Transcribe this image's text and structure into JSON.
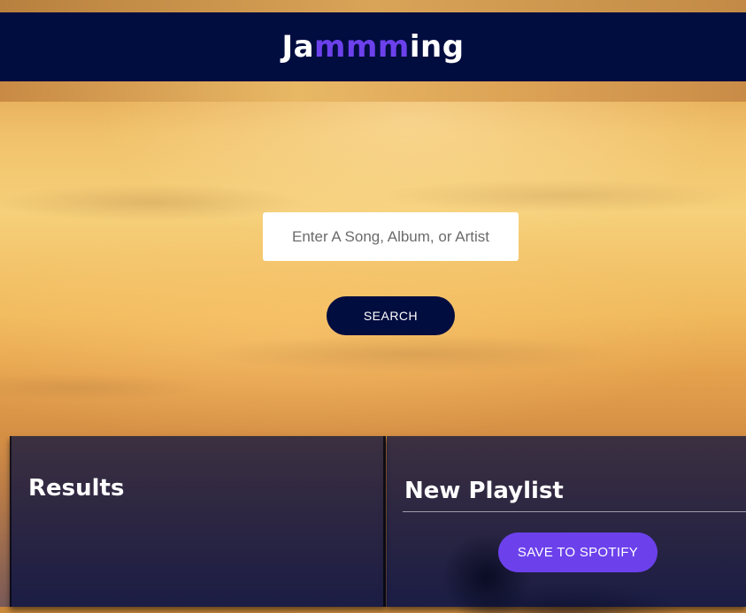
{
  "app": {
    "logo": {
      "part1": "Ja",
      "accent": "mmm",
      "part2": "ing"
    }
  },
  "search": {
    "placeholder": "Enter A Song, Album, or Artist",
    "button_label": "SEARCH"
  },
  "results": {
    "title": "Results"
  },
  "playlist": {
    "name": "New Playlist",
    "save_label": "SAVE TO SPOTIFY"
  },
  "colors": {
    "header_bg": "#010c3f",
    "accent": "#6c41ec",
    "search_button_bg": "#010c3f"
  }
}
